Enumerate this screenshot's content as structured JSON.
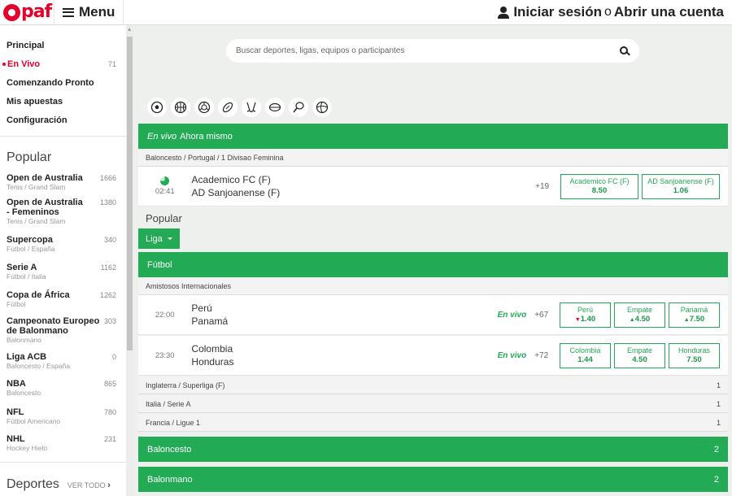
{
  "header": {
    "logo_text": "paf",
    "menu_label": "Menu",
    "login_label": "Iniciar sesión",
    "or_label": "o",
    "register_label": "Abrir una cuenta"
  },
  "sidebar": {
    "nav": [
      {
        "label": "Principal",
        "count": ""
      },
      {
        "label": "En Vivo",
        "count": "71"
      },
      {
        "label": "Comenzando Pronto",
        "count": ""
      },
      {
        "label": "Mis apuestas",
        "count": ""
      },
      {
        "label": "Configuración",
        "count": ""
      }
    ],
    "popular_title": "Popular",
    "popular": [
      {
        "name": "Open de Australia",
        "sub": "Tenis / Grand Slam",
        "count": "1666"
      },
      {
        "name": "Open de Australia - Femeninos",
        "sub": "Tenis / Grand Slam",
        "count": "1380"
      },
      {
        "name": "Supercopa",
        "sub": "Fútbol / España",
        "count": "340"
      },
      {
        "name": "Serie A",
        "sub": "Fútbol / Italia",
        "count": "1162"
      },
      {
        "name": "Copa de África",
        "sub": "Fútbol",
        "count": "1262"
      },
      {
        "name": "Campeonato Europeo de Balonmano",
        "sub": "Balonmano",
        "count": "303"
      },
      {
        "name": "Liga ACB",
        "sub": "Baloncesto / España",
        "count": "0"
      },
      {
        "name": "NBA",
        "sub": "Baloncesto",
        "count": "865"
      },
      {
        "name": "NFL",
        "sub": "Fútbol Americano",
        "count": "780"
      },
      {
        "name": "NHL",
        "sub": "Hockey Hielo",
        "count": "231"
      }
    ],
    "deportes_title": "Deportes",
    "ver_todo": "VER TODO"
  },
  "search": {
    "placeholder": "Buscar deportes, ligas, equipos o participantes"
  },
  "sport_icons": [
    "soccer-icon",
    "basketball-icon",
    "volleyball-icon",
    "american-football-icon",
    "ice-hockey-icon",
    "rugby-icon",
    "tennis-icon",
    "handball-icon"
  ],
  "live_section": {
    "live_word": "En vivo",
    "title": "Ahora mismo",
    "league": "Baloncesto / Portugal / 1 Divisao Feminina",
    "match": {
      "time": "02:41",
      "team1": "Academico FC (F)",
      "team2": "AD Sanjoanense (F)",
      "more": "+19",
      "odds": [
        {
          "label": "Academico FC (F)",
          "price": "8.50"
        },
        {
          "label": "AD Sanjoanense (F)",
          "price": "1.06"
        }
      ]
    }
  },
  "popular_section": {
    "title": "Popular",
    "liga_button": "Liga",
    "futbol_label": "Fútbol",
    "league1": "Amistosos Internacionales",
    "matches": [
      {
        "time": "22:00",
        "team1": "Perú",
        "team2": "Panamá",
        "live": "En vivo",
        "more": "+67",
        "odds": [
          {
            "label": "Perú",
            "price": "1.40",
            "arrow": "▼"
          },
          {
            "label": "Empate",
            "price": "4.50",
            "arrow": "▲"
          },
          {
            "label": "Panamá",
            "price": "7.50",
            "arrow": "▲"
          }
        ]
      },
      {
        "time": "23:30",
        "team1": "Colombia",
        "team2": "Honduras",
        "live": "En vivo",
        "more": "+72",
        "odds": [
          {
            "label": "Colombia",
            "price": "1.44",
            "arrow": ""
          },
          {
            "label": "Empate",
            "price": "4.50",
            "arrow": ""
          },
          {
            "label": "Honduras",
            "price": "7.50",
            "arrow": ""
          }
        ]
      }
    ],
    "other_leagues": [
      {
        "name": "Inglaterra / Superliga (F)",
        "count": "1"
      },
      {
        "name": "Italia / Serie A",
        "count": "1"
      },
      {
        "name": "Francia / Ligue 1",
        "count": "1"
      }
    ],
    "sports": [
      {
        "name": "Baloncesto",
        "count": "2"
      },
      {
        "name": "Balonmano",
        "count": "2"
      }
    ]
  }
}
